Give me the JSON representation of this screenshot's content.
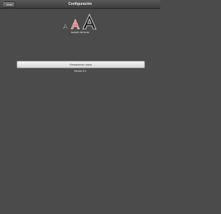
{
  "navbar": {
    "back_label": "Atrás",
    "title": "Configuración"
  },
  "font_size": {
    "label": "tamaño del texto",
    "options": [
      {
        "name": "small",
        "selected": false
      },
      {
        "name": "medium",
        "selected": true
      },
      {
        "name": "large",
        "selected": false
      }
    ],
    "selected_color": "#e05a5a"
  },
  "actions": {
    "restore_label": "Restablecer datos"
  },
  "footer": {
    "version": "Versión 8.1"
  }
}
